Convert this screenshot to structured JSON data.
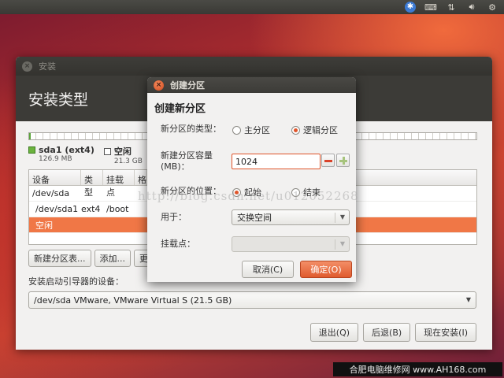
{
  "colors": {
    "accent": "#e0542a",
    "selection": "#f07746",
    "header": "#3c3b37"
  },
  "top_panel": {
    "icons": [
      "accessibility-icon",
      "keyboard-icon",
      "network-icon",
      "volume-icon",
      "gear-icon"
    ]
  },
  "installer": {
    "window_title": "安装",
    "header_title": "安装类型",
    "legend": [
      {
        "name": "sda1 (ext4)",
        "size": "126.9 MB"
      },
      {
        "name": "空闲",
        "size": "21.3 GB"
      }
    ],
    "table": {
      "columns": [
        "设备",
        "类型",
        "挂载点",
        "格"
      ],
      "rows": [
        {
          "device": "/dev/sda",
          "type": "",
          "mount": ""
        },
        {
          "device": "/dev/sda1",
          "type": "ext4",
          "mount": "/boot"
        },
        {
          "device": "空闲",
          "type": "",
          "mount": ""
        }
      ]
    },
    "buttons": {
      "new_table": "新建分区表...",
      "add": "添加...",
      "change": "更改"
    },
    "bootloader_label": "安装启动引导器的设备：",
    "bootloader_value": "/dev/sda   VMware, VMware Virtual S (21.5 GB)",
    "bottom_buttons": {
      "quit": "退出(Q)",
      "back": "后退(B)",
      "install_now": "现在安装(I)"
    }
  },
  "dialog": {
    "title": "创建分区",
    "heading": "创建新分区",
    "type_label": "新分区的类型：",
    "type_primary": "主分区",
    "type_logical": "逻辑分区",
    "size_label_line1": "新建分区容量",
    "size_label_line2": "(MB)：",
    "size_value": "1024",
    "location_label": "新分区的位置：",
    "location_begin": "起始",
    "location_end": "结束",
    "use_label": "用于：",
    "use_value": "交换空间",
    "mount_label": "挂载点：",
    "mount_value": "",
    "cancel": "取消(C)",
    "ok": "确定(O)"
  },
  "watermark": "http://blog.csdn.net/u012052268",
  "site_badge": "合肥电脑维修网 www.AH168.com"
}
